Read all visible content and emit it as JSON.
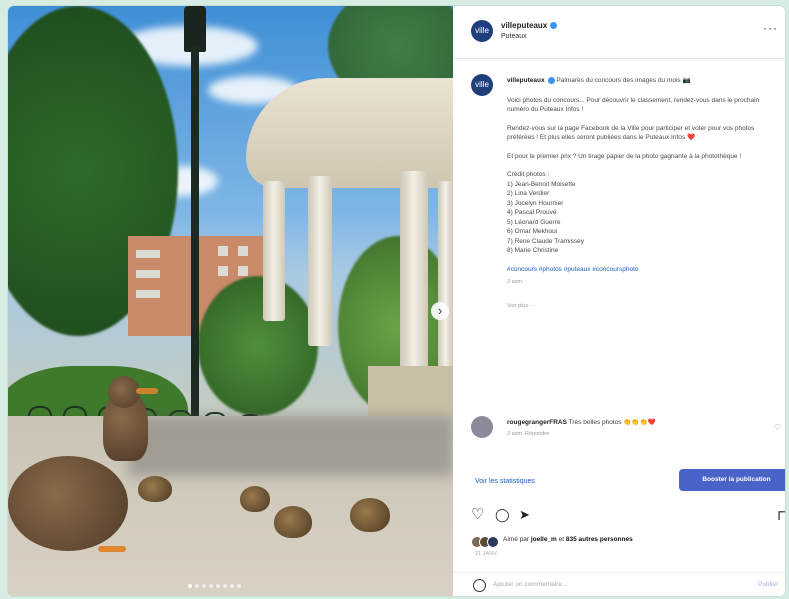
{
  "post": {
    "account": "villeputeaux",
    "location": "Puteaux",
    "more_label": "···",
    "avatar_text": "ville",
    "caption_account": "villeputeaux",
    "caption_title": "Palmarès du concours des images du mois 📷",
    "caption_p1": "Voici photos du concours... Pour découvrir le classement, rendez-vous dans le prochain numéro du Puteaux Infos !",
    "caption_p2": "Rendez-vous sur la page Facebook de la Ville pour participer et voter pour vos photos préférées ! Et plus elles seront publiées dans le Puteaux Infos ❤️",
    "caption_p3": "Et pour le premier prix ? Un tirage papier de la photo gagnante à la photothèque !",
    "credits_title": "Crédit photos :",
    "credits": [
      "1) Jean-Benoit Moisette",
      "2) Lina Verdier",
      "3) Jocelyn Hournier",
      "4) Pascal Prouvé",
      "5) Léonard Guerre",
      "6) Omar Mekhoui",
      "7) Rene Claude Tramissey",
      "8) Marie Christine"
    ],
    "hashtags": "#concours #photos #puteaux #concoursphoto",
    "caption_time": "3 sem.",
    "see_translation": "Voir plus ···",
    "comment_user": "rougegrangerFRAS",
    "comment_text": "Très belles photos 👏👏👏❤️",
    "comment_meta": "3 sem.   Répondre",
    "stats_link": "Voir les statistiques",
    "boost_button": "Booster la publication",
    "likes_prefix": "Aimé par ",
    "likes_user": "joelle_m",
    "likes_mid": " et ",
    "likes_count": "835 autres personnes",
    "days": "21 JANV.",
    "add_comment_placeholder": "Ajouter un commentaire...",
    "publish_label": "Publier"
  },
  "icons": {
    "arrow": "›",
    "heart": "♡",
    "comment": "◯",
    "share": "➤",
    "save": "⊓"
  }
}
